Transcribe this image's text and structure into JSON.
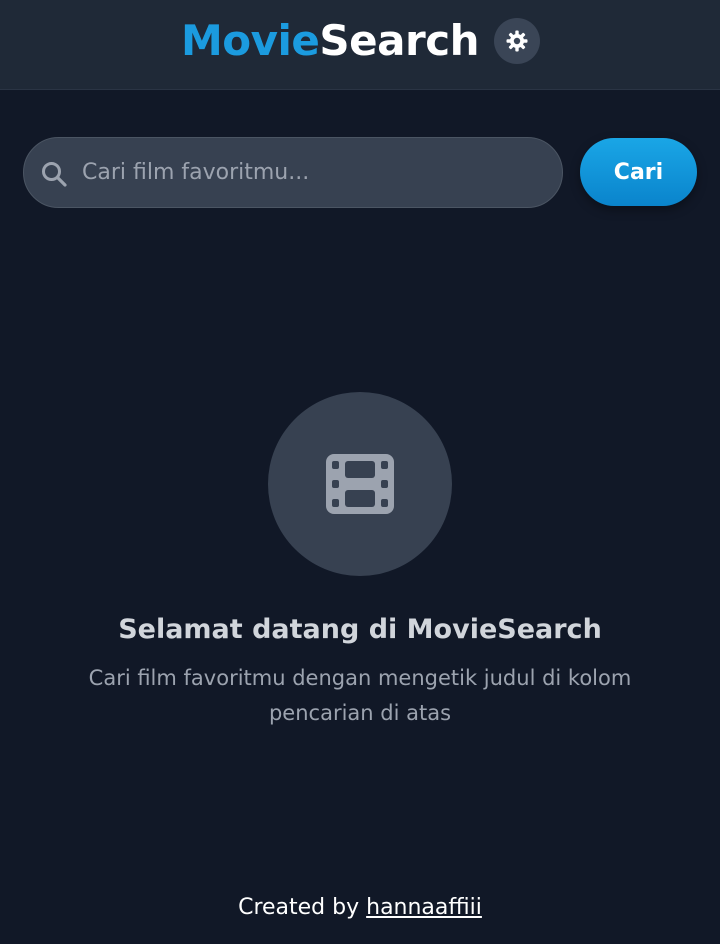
{
  "header": {
    "logo_part1": "Movie",
    "logo_part2": "Search",
    "theme_toggle_icon": "gear-icon"
  },
  "search": {
    "placeholder": "Cari film favoritmu...",
    "value": "",
    "button_label": "Cari"
  },
  "welcome": {
    "icon": "film-icon",
    "title": "Selamat datang di MovieSearch",
    "text": "Cari film favoritmu dengan mengetik judul di kolom pencarian di atas"
  },
  "footer": {
    "prefix": "Created by",
    "author": "hannaaffiii"
  },
  "colors": {
    "background": "#111827",
    "header_bg": "#1f2937",
    "accent": "#1b9bdf",
    "input_bg": "#374151"
  }
}
